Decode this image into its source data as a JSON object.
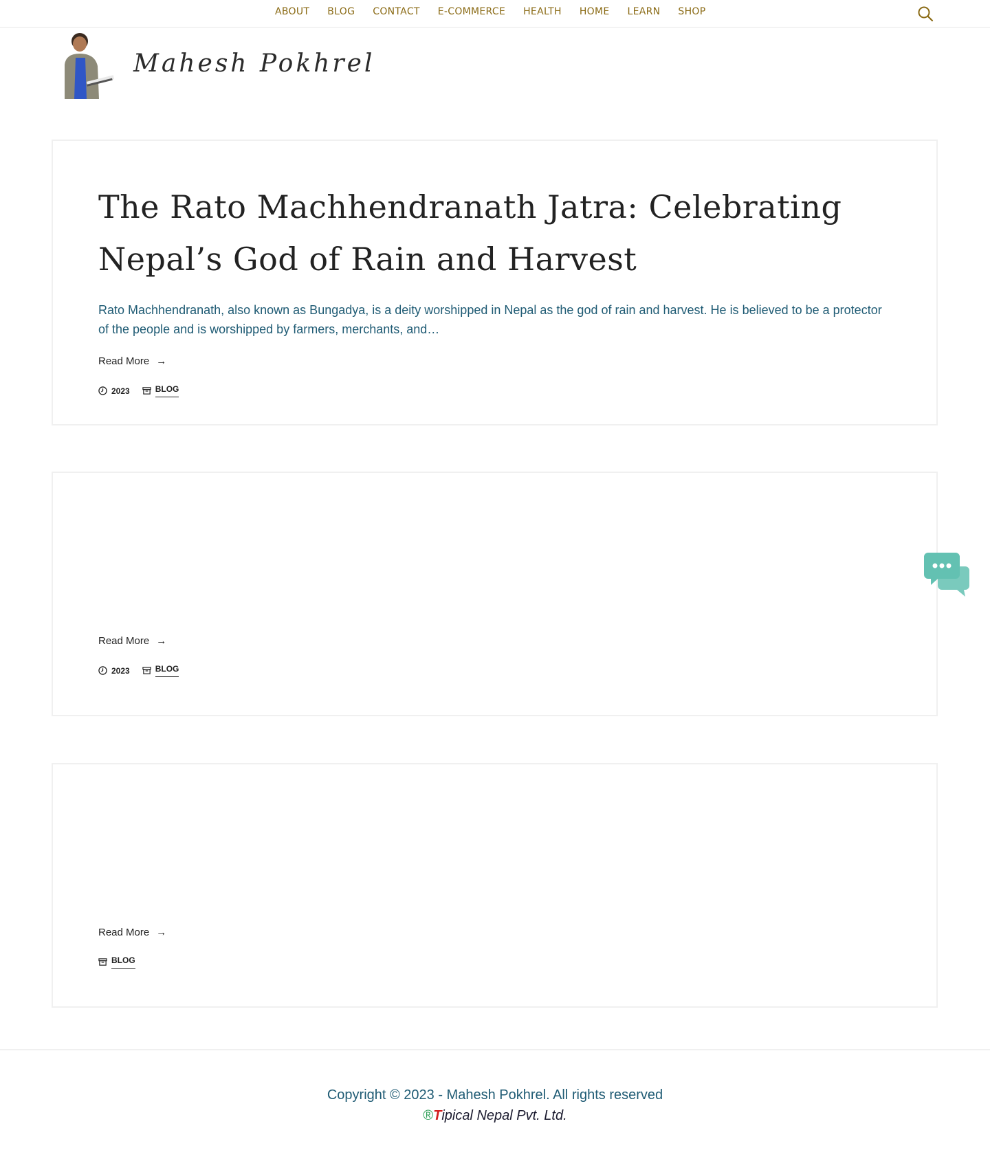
{
  "nav": {
    "items": [
      "About",
      "Blog",
      "Contact",
      "E-Commerce",
      "Health",
      "Home",
      "Learn",
      "Shop"
    ],
    "search_icon": "search-icon"
  },
  "brand": {
    "site_name": "Mahesh Pokhrel"
  },
  "posts": [
    {
      "title": "The Rato Machhendranath Jatra: Celebrating Nepal’s God of Rain and Harvest",
      "excerpt": "Rato Machhendranath, also known as Bungadya, is a deity worshipped in Nepal as the god of rain and harvest. He is believed to be a protector of the people and is worshipped by farmers, merchants, and…",
      "read_more": "Read More",
      "date": "2023",
      "category": "BLOG"
    },
    {
      "title": "",
      "excerpt": "",
      "read_more": "Read More",
      "date": "2023",
      "category": "BLOG"
    },
    {
      "title": "",
      "excerpt": "",
      "read_more": "Read More",
      "category": "BLOG"
    }
  ],
  "footer": {
    "copyright": "Copyright © 2023 - Mahesh Pokhrel. All rights reserved",
    "credit_reg": "®",
    "credit_t": "T",
    "credit_rest": "ipical Nepal Pvt. Ltd."
  },
  "colors": {
    "nav_text": "#8a6a14",
    "excerpt_text": "#1f5b74",
    "chat_icon": "#63c1b2",
    "credit_reg": "#2e9e57",
    "credit_t": "#d41f1f"
  }
}
